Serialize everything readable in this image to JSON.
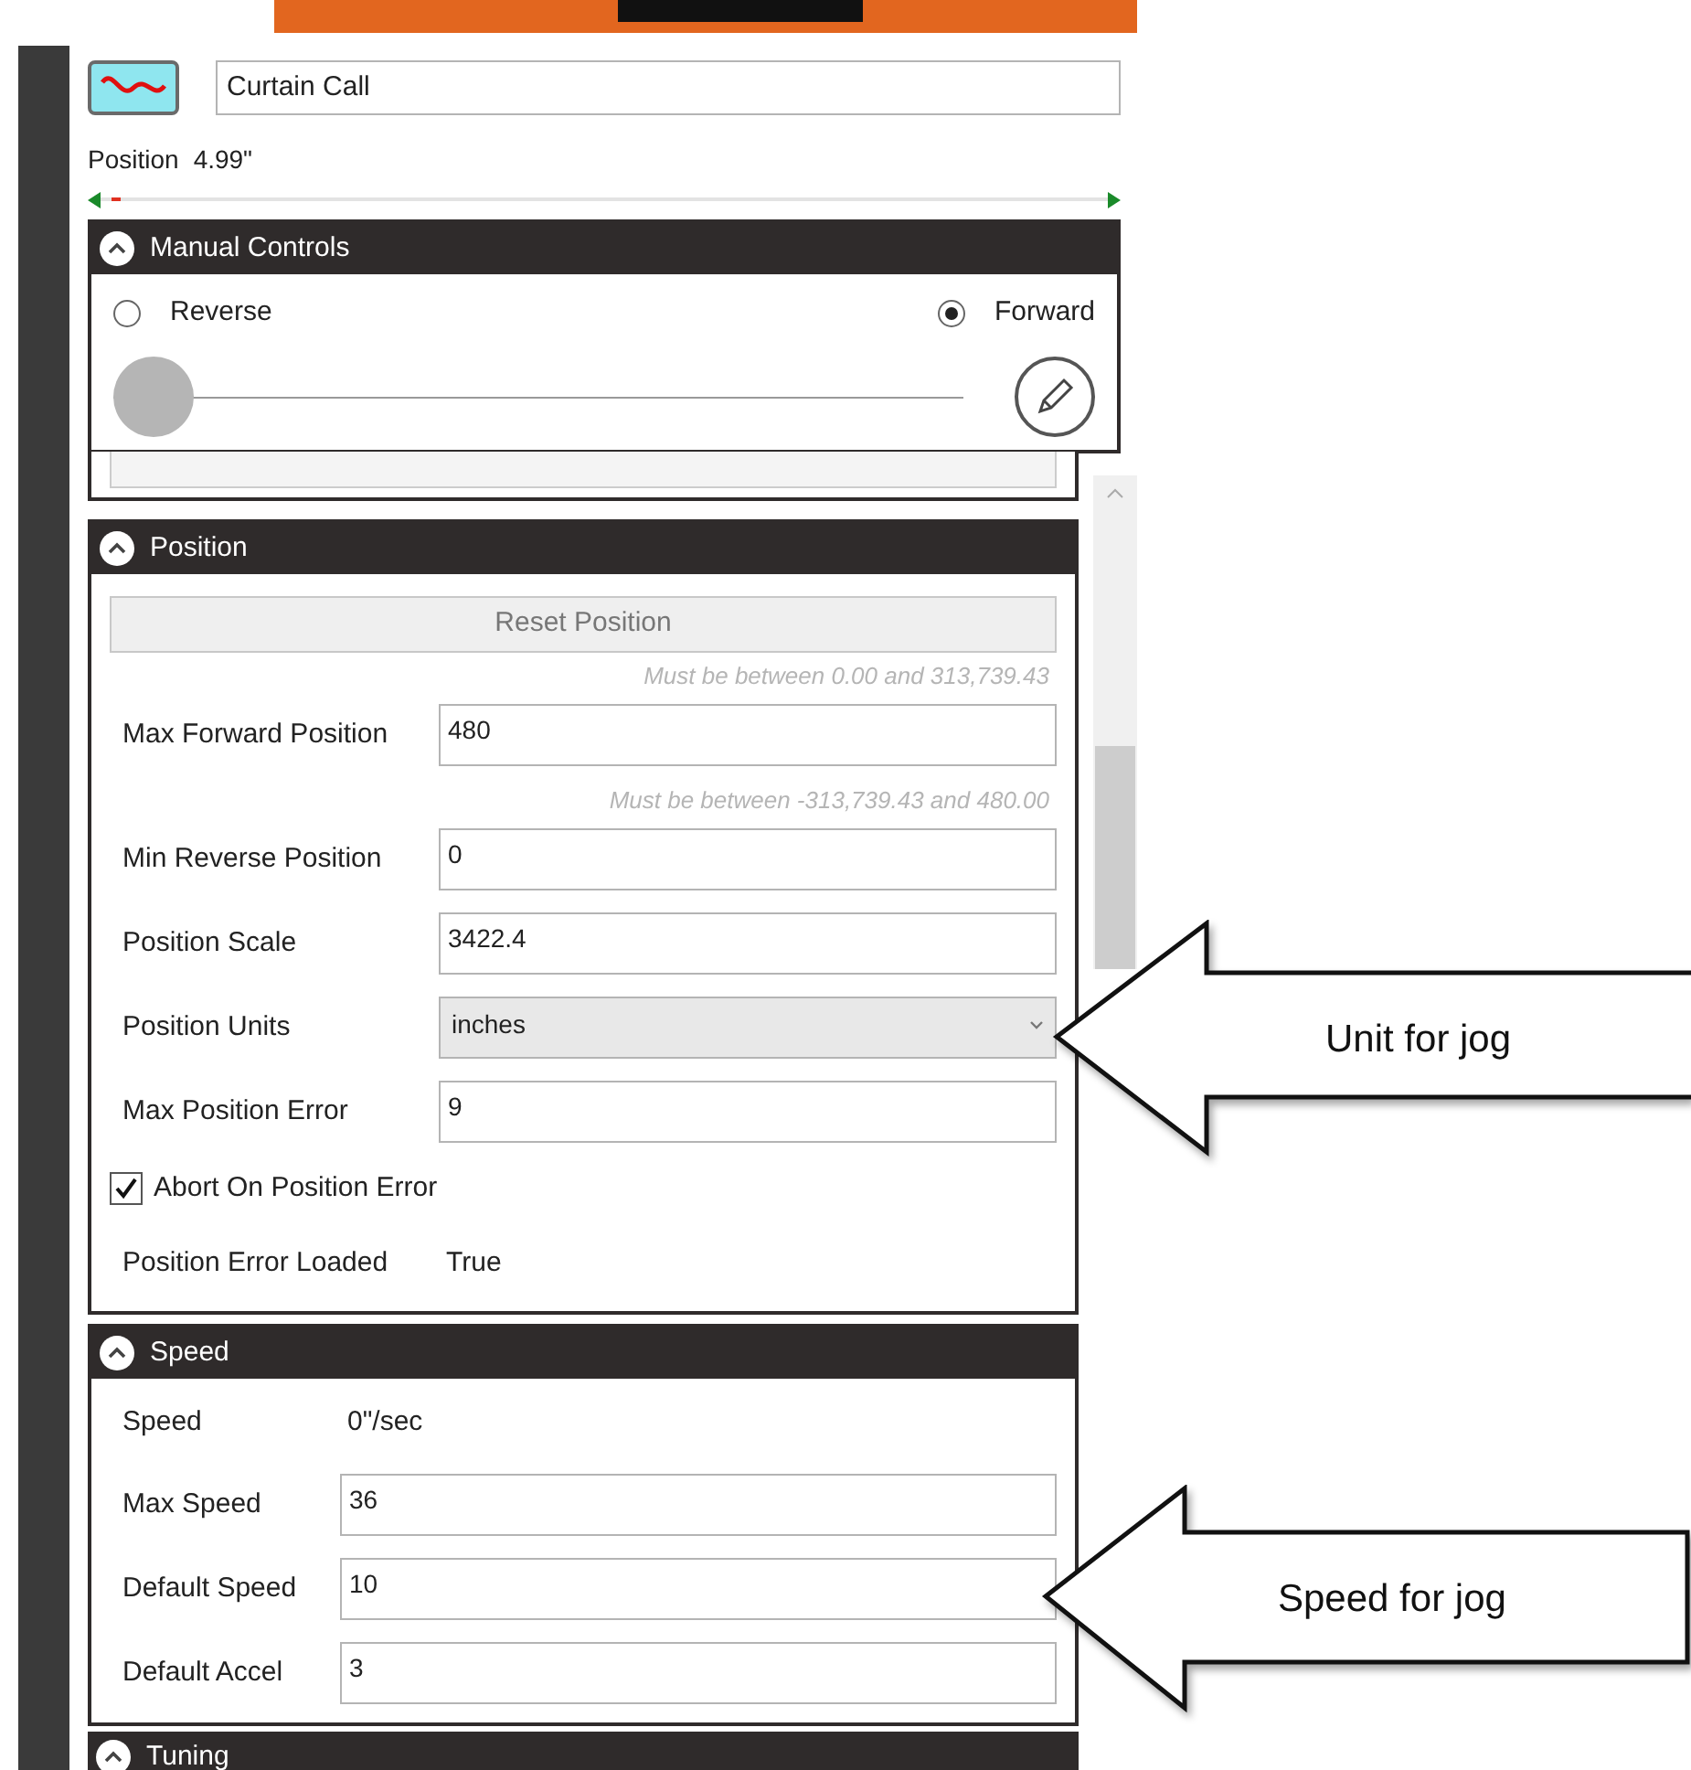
{
  "header": {
    "name_field": "Curtain Call"
  },
  "position": {
    "label": "Position",
    "value": "4.99\"",
    "level": 0.01
  },
  "manual_controls": {
    "title": "Manual Controls",
    "expanded": true,
    "directions": [
      {
        "label": "Reverse",
        "selected": false
      },
      {
        "label": "Forward",
        "selected": true
      }
    ],
    "level": 0
  },
  "position_section": {
    "title": "Position",
    "expanded": true,
    "reset_button": "Reset Position",
    "rows": [
      {
        "kind": "hint",
        "text": "Must be between 0.00 and 313,739.43"
      },
      {
        "kind": "input",
        "label": "Max Forward Position",
        "value": "480"
      },
      {
        "kind": "hint",
        "text": "Must be between -313,739.43 and 480.00"
      },
      {
        "kind": "input",
        "label": "Min Reverse Position",
        "value": "0"
      },
      {
        "kind": "input",
        "label": "Position Scale",
        "value": "3422.4"
      },
      {
        "kind": "select",
        "label": "Position Units",
        "value": "inches"
      },
      {
        "kind": "input",
        "label": "Max Position Error",
        "value": "9"
      },
      {
        "kind": "checkbox",
        "label": "Abort On Position Error",
        "checked": true
      },
      {
        "kind": "readout",
        "label": "Position Error Loaded",
        "value": "True"
      }
    ]
  },
  "speed_section": {
    "title": "Speed",
    "expanded": true,
    "rows": [
      {
        "kind": "readout",
        "label": "Speed",
        "value": "0\"/sec"
      },
      {
        "kind": "input",
        "label": "Max Speed",
        "value": "36"
      },
      {
        "kind": "input",
        "label": "Default Speed",
        "value": "10"
      },
      {
        "kind": "input",
        "label": "Default Accel",
        "value": "3"
      }
    ]
  },
  "tuning_section": {
    "title": "Tuning",
    "expanded": true
  },
  "callouts": [
    {
      "text": "Unit for jog"
    },
    {
      "text": "Speed for jog"
    }
  ]
}
